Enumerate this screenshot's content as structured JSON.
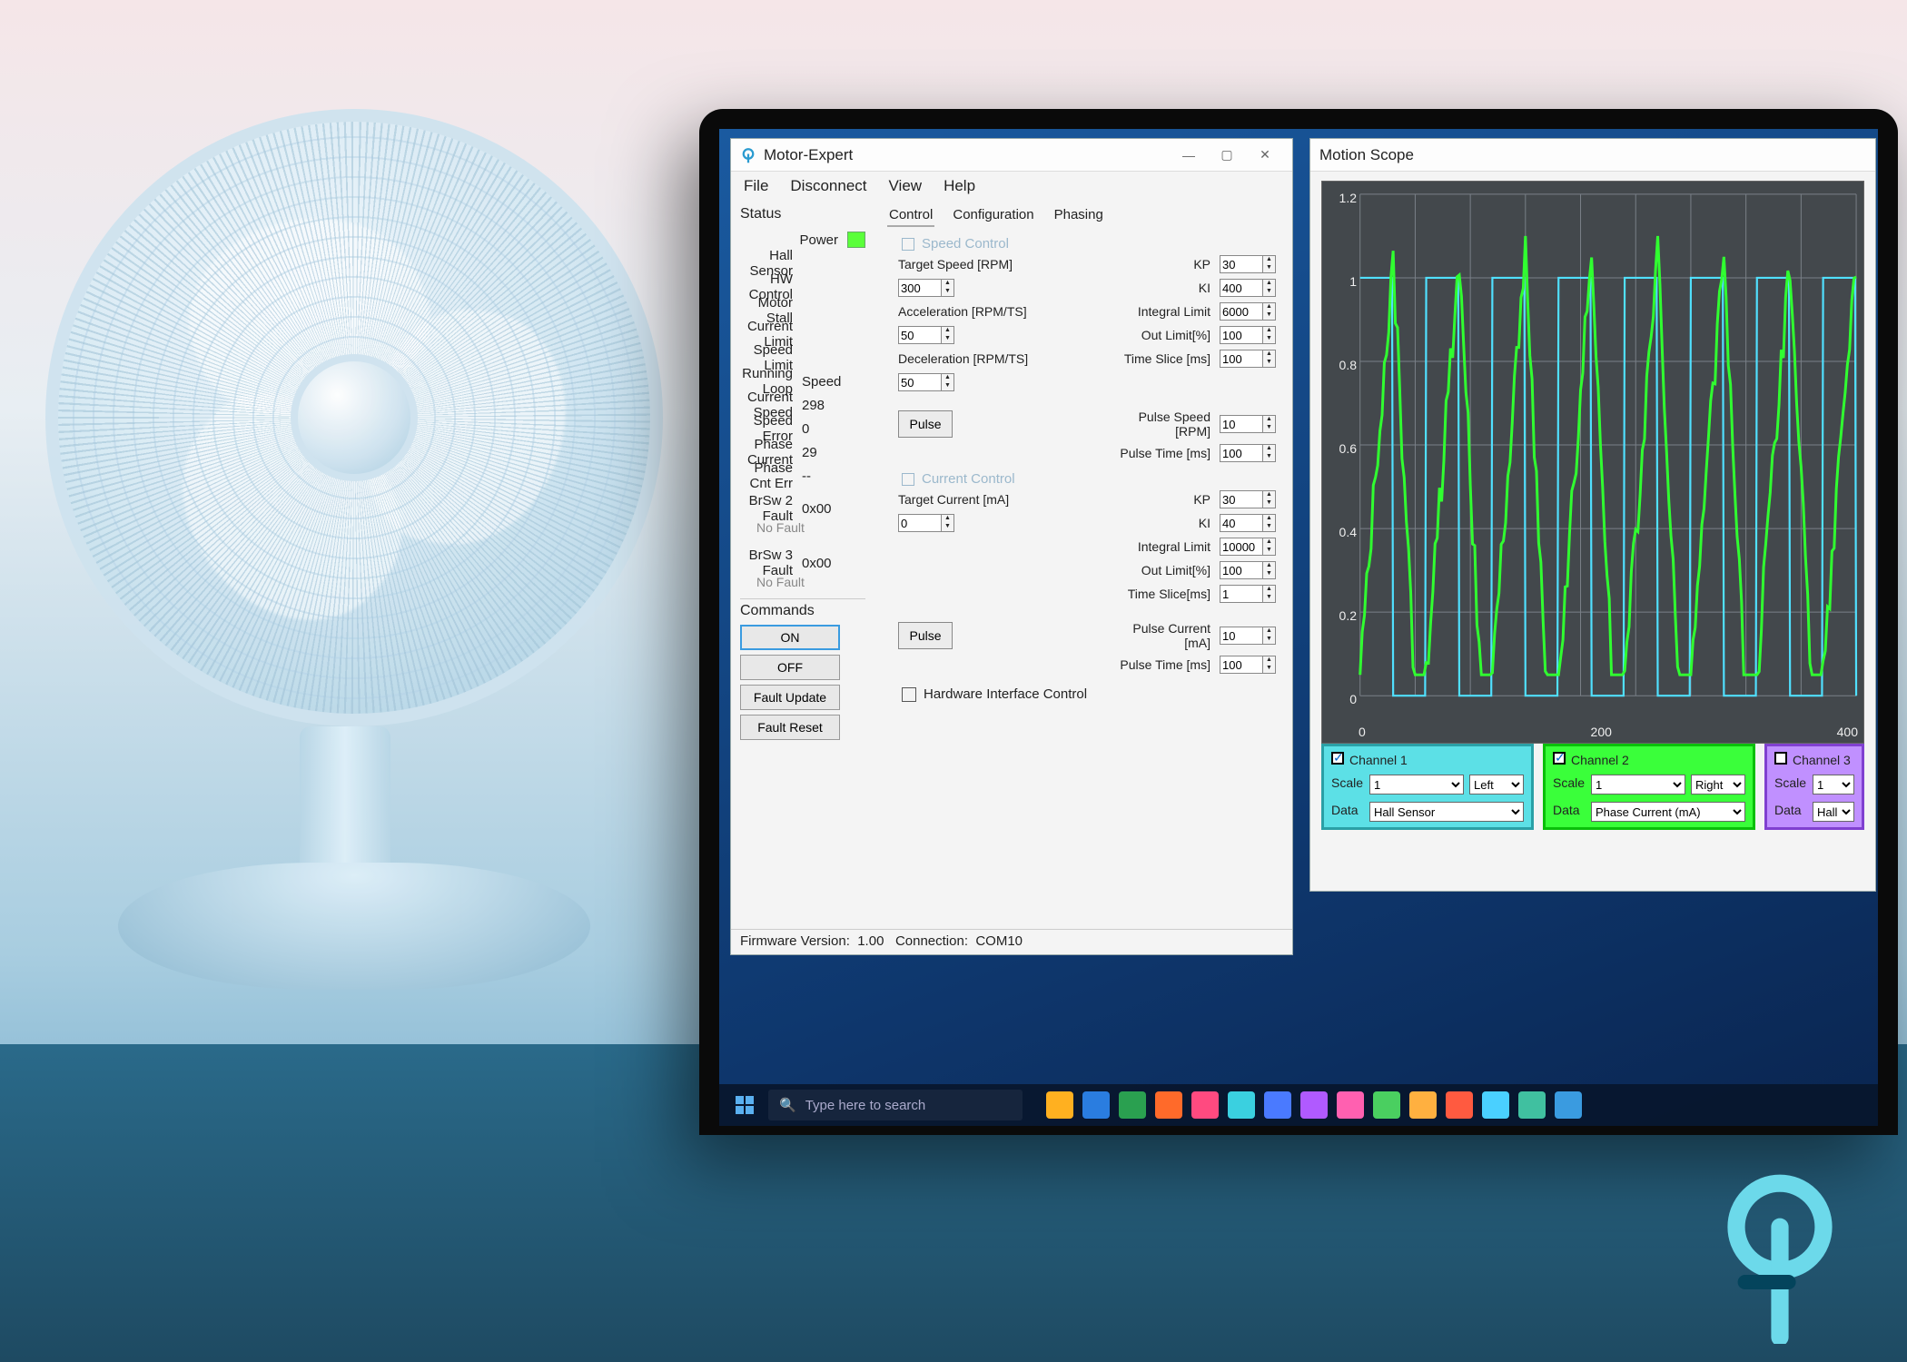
{
  "app": {
    "title": "Motor-Expert",
    "menus": [
      "File",
      "Disconnect",
      "View",
      "Help"
    ]
  },
  "status": {
    "heading": "Status",
    "rows": {
      "power": "Power",
      "hall_sensor": "Hall Sensor",
      "hw_control": "HW Control",
      "motor_stall": "Motor Stall",
      "current_limit": "Current Limit",
      "speed_limit": "Speed Limit",
      "running_loop_label": "Running Loop",
      "running_loop_value": "Speed",
      "current_speed_label": "Current Speed",
      "current_speed_value": "298",
      "speed_error_label": "Speed Error",
      "speed_error_value": "0",
      "phase_current_label": "Phase Current",
      "phase_current_value": "29",
      "phase_cnt_err_label": "Phase Cnt Err",
      "phase_cnt_err_value": "--",
      "brsw2_label": "BrSw 2 Fault",
      "brsw2_value": "0x00",
      "brsw2_msg": "No Fault",
      "brsw3_label": "BrSw 3 Fault",
      "brsw3_value": "0x00",
      "brsw3_msg": "No Fault"
    }
  },
  "commands": {
    "heading": "Commands",
    "on": "ON",
    "off": "OFF",
    "fault_update": "Fault Update",
    "fault_reset": "Fault Reset"
  },
  "tabs": {
    "control": "Control",
    "configuration": "Configuration",
    "phasing": "Phasing"
  },
  "speed_control": {
    "title": "Speed Control",
    "target_speed_label": "Target Speed [RPM]",
    "target_speed": "300",
    "accel_label": "Acceleration [RPM/TS]",
    "accel": "50",
    "decel_label": "Deceleration [RPM/TS]",
    "decel": "50",
    "kp_label": "KP",
    "kp": "30",
    "ki_label": "KI",
    "ki": "400",
    "int_limit_label": "Integral Limit",
    "int_limit": "6000",
    "out_limit_label": "Out Limit[%]",
    "out_limit": "100",
    "time_slice_label": "Time Slice [ms]",
    "time_slice": "100",
    "pulse_btn": "Pulse",
    "pulse_speed_label": "Pulse Speed [RPM]",
    "pulse_speed": "10",
    "pulse_time_label": "Pulse Time [ms]",
    "pulse_time": "100"
  },
  "current_control": {
    "title": "Current Control",
    "target_current_label": "Target Current [mA]",
    "target_current": "0",
    "kp_label": "KP",
    "kp": "30",
    "ki_label": "KI",
    "ki": "40",
    "int_limit_label": "Integral Limit",
    "int_limit": "10000",
    "out_limit_label": "Out Limit[%]",
    "out_limit": "100",
    "time_slice_label": "Time Slice[ms]",
    "time_slice": "1",
    "pulse_btn": "Pulse",
    "pulse_current_label": "Pulse Current [mA]",
    "pulse_current": "10",
    "pulse_time_label": "Pulse Time [ms]",
    "pulse_time": "100"
  },
  "hw_interface_label": "Hardware Interface Control",
  "footer": {
    "fw_label": "Firmware Version:",
    "fw": "1.00",
    "conn_label": "Connection:",
    "conn": "COM10"
  },
  "scope": {
    "title": "Motion Scope",
    "channels": {
      "c1": {
        "name": "Channel 1",
        "scale_label": "Scale",
        "scale": "1",
        "align": "Left",
        "data_label": "Data",
        "data": "Hall Sensor",
        "checked": true
      },
      "c2": {
        "name": "Channel 2",
        "scale_label": "Scale",
        "scale": "1",
        "align": "Right",
        "data_label": "Data",
        "data": "Phase Current (mA)",
        "checked": true
      },
      "c3": {
        "name": "Channel 3",
        "scale_label": "Scale",
        "scale": "1",
        "data_label": "Data",
        "data": "Hall Sen",
        "checked": false
      }
    }
  },
  "chart_data": {
    "type": "line",
    "xlim": [
      0,
      450
    ],
    "ylim": [
      0,
      1.2
    ],
    "yticks": [
      "1.2",
      "1",
      "0.8",
      "0.6",
      "0.4",
      "0.2",
      "0"
    ],
    "xticks": [
      "0",
      "200",
      "400"
    ],
    "series": [
      {
        "name": "Hall Sensor",
        "color": "#50e0ff",
        "shape": "square",
        "period": 60,
        "low": 0,
        "high": 1
      },
      {
        "name": "Phase Current (mA)",
        "color": "#30ff30",
        "shape": "noisy-saw",
        "period": 60,
        "low": 0.05,
        "high": 1.05
      }
    ]
  },
  "taskbar": {
    "search_placeholder": "Type here to search",
    "icon_colors": [
      "#ffb020",
      "#2a7de0",
      "#2aa050",
      "#ff6a2a",
      "#ff4a80",
      "#3ad0e0",
      "#4a7aff",
      "#b05aff",
      "#ff60b0",
      "#4acf60",
      "#ffb040",
      "#ff5a40",
      "#4ad0ff",
      "#40c0a0",
      "#3a9be0"
    ]
  }
}
